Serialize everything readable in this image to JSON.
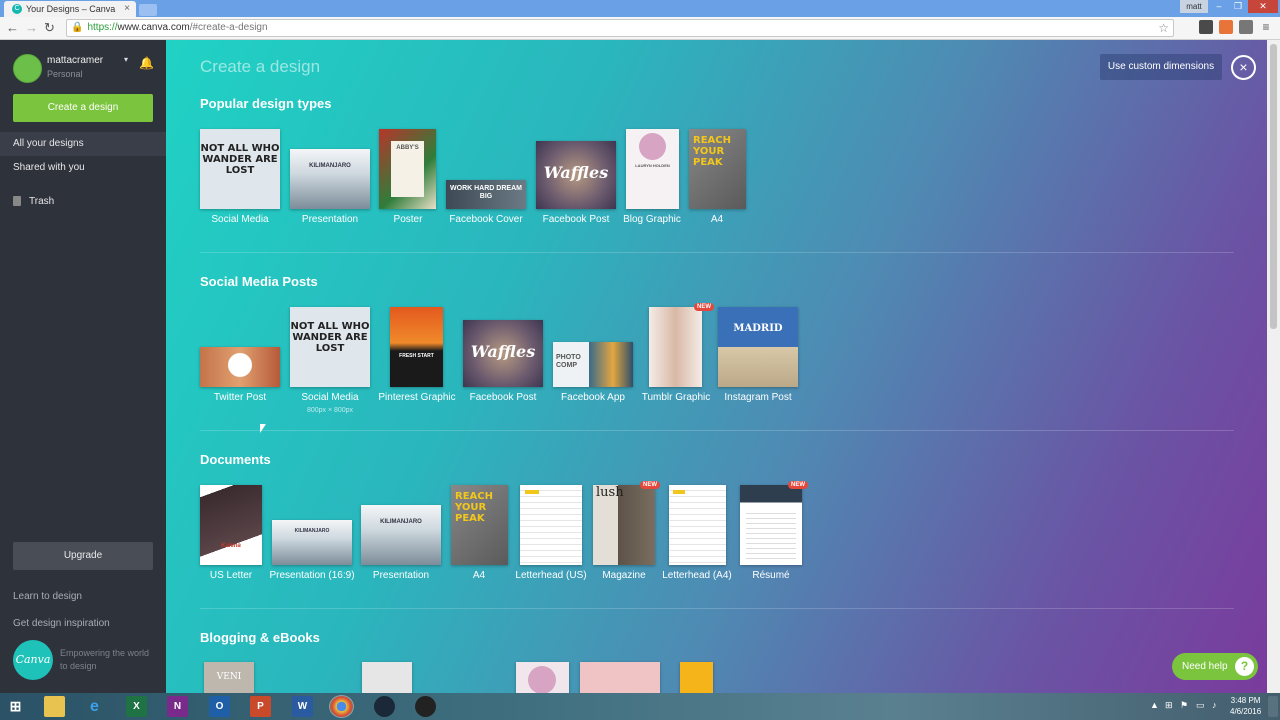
{
  "browser": {
    "tab_title": "Your Designs – Canva",
    "tab_favicon": "C",
    "tab_close": "×",
    "url_scheme": "https://",
    "url_host": "www.canva.com",
    "url_path": "/#create-a-design",
    "window_user": "matt",
    "back": "←",
    "forward": "→",
    "reload": "↻",
    "minimize": "–",
    "restore": "❐",
    "close": "✕",
    "star": "☆"
  },
  "sidebar": {
    "username": "mattacramer",
    "plan": "Personal",
    "caret": "▾",
    "create_label": "Create a design",
    "nav": [
      {
        "label": "All your designs",
        "active": true
      },
      {
        "label": "Shared with you",
        "active": false
      },
      {
        "label": "Trash",
        "active": false
      }
    ],
    "upgrade_label": "Upgrade",
    "learn_label": "Learn to design",
    "inspiration_label": "Get design inspiration",
    "logo_text": "Canva",
    "tagline": "Empowering the world to design"
  },
  "main": {
    "title": "Create a design",
    "custom_dimensions_label": "Use custom dimensions",
    "close_glyph": "×",
    "help_label": "Need help",
    "help_glyph": "?",
    "new_badge": "NEW",
    "sections": [
      {
        "title": "Popular design types",
        "items": [
          {
            "label": "Social Media",
            "thumb_text": "NOT ALL WHO WANDER ARE LOST",
            "color": "#dbe3e9"
          },
          {
            "label": "Presentation",
            "thumb_text": "KILIMANJARO",
            "color": "#b9c8d4"
          },
          {
            "label": "Poster",
            "thumb_text": "ABBY'S",
            "color": "#c0392b"
          },
          {
            "label": "Facebook Cover",
            "thumb_text": "WORK HARD DREAM BIG",
            "color": "#2c3e50"
          },
          {
            "label": "Facebook Post",
            "thumb_text": "Waffles",
            "color": "#5b4a7a"
          },
          {
            "label": "Blog Graphic",
            "thumb_text": "LAURYN HOLDEN",
            "color": "#f3eef0"
          },
          {
            "label": "A4",
            "thumb_text": "REACH YOUR PEAK",
            "color": "#6b6b6b"
          }
        ]
      },
      {
        "title": "Social Media Posts",
        "items": [
          {
            "label": "Twitter Post",
            "color": "#c4744a"
          },
          {
            "label": "Social Media",
            "sublabel": "800px × 800px",
            "thumb_text": "NOT ALL WHO WANDER ARE LOST",
            "color": "#dbe3e9"
          },
          {
            "label": "Pinterest Graphic",
            "thumb_text": "FRESH START",
            "color": "#d8561c"
          },
          {
            "label": "Facebook Post",
            "thumb_text": "Waffles",
            "color": "#5b4a7a"
          },
          {
            "label": "Facebook App",
            "thumb_text": "PHOTO COMP",
            "color": "#e9eef2"
          },
          {
            "label": "Tumblr Graphic",
            "color": "#e8d8cf"
          },
          {
            "label": "Instagram Post",
            "thumb_text": "MADRID",
            "color": "#3b6fb3"
          }
        ]
      },
      {
        "title": "Documents",
        "items": [
          {
            "label": "US Letter",
            "thumb_text": "Kalena",
            "color": "#3a2b2e"
          },
          {
            "label": "Presentation (16:9)",
            "thumb_text": "KILIMANJARO",
            "color": "#b9c8d4"
          },
          {
            "label": "Presentation",
            "thumb_text": "KILIMANJARO",
            "color": "#b9c8d4"
          },
          {
            "label": "A4",
            "thumb_text": "REACH YOUR PEAK",
            "color": "#6b6b6b"
          },
          {
            "label": "Letterhead (US)",
            "color": "#ffffff"
          },
          {
            "label": "Magazine",
            "thumb_text": "lush",
            "color": "#e3ded6"
          },
          {
            "label": "Letterhead (A4)",
            "color": "#ffffff"
          },
          {
            "label": "Résumé",
            "color": "#ffffff"
          }
        ]
      },
      {
        "title": "Blogging & eBooks",
        "items": [
          {
            "thumb_text": "VENI",
            "color": "#bdb7ae"
          },
          {
            "color": "#e6e6e6"
          },
          {
            "color": "#f1e6ec"
          },
          {
            "color": "#f0c4c4"
          },
          {
            "color": "#f4b41a"
          }
        ]
      }
    ]
  },
  "taskbar": {
    "time": "3:48 PM",
    "date": "4/6/2016",
    "apps": [
      "windows-start",
      "file-explorer",
      "internet-explorer",
      "excel",
      "onenote",
      "outlook",
      "powerpoint",
      "word",
      "chrome",
      "steam",
      "obs"
    ]
  }
}
